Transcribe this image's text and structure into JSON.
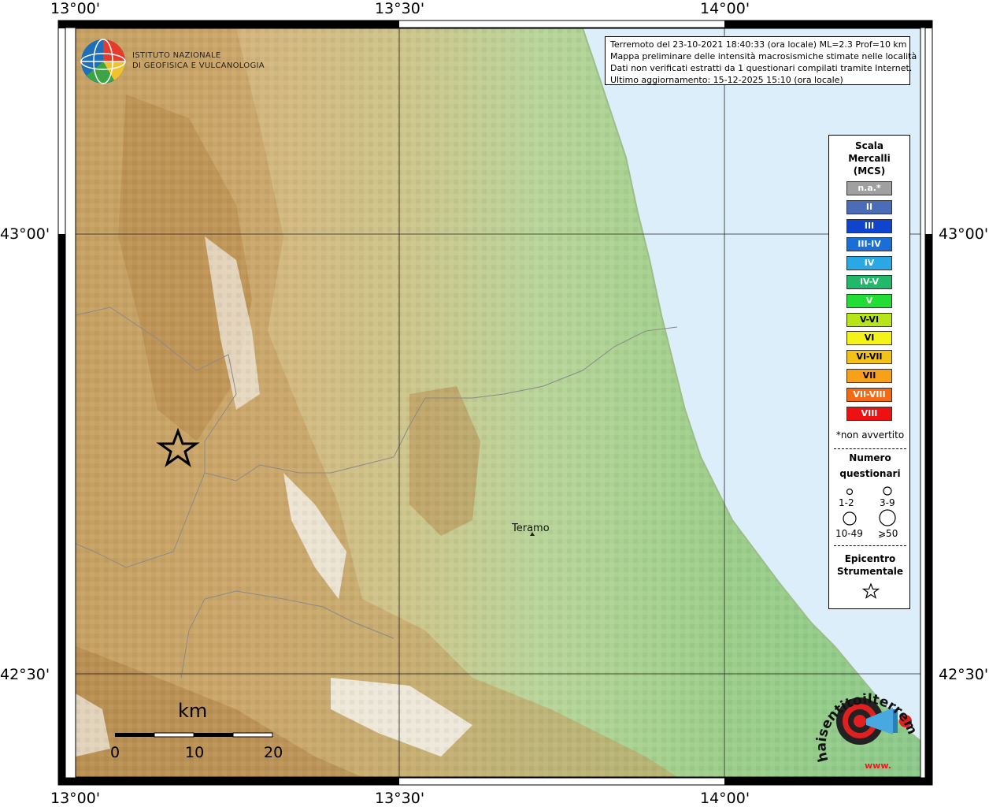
{
  "map": {
    "top_labels": [
      "13°00'",
      "13°30'",
      "14°00'"
    ],
    "bottom_labels": [
      "13°00'",
      "13°30'",
      "14°00'"
    ],
    "left_labels": [
      "43°00'",
      "42°30'"
    ],
    "right_labels": [
      "43°00'",
      "42°30'"
    ],
    "town": "Teramo",
    "epicenter_icon": "star-icon"
  },
  "institute": {
    "name_line1": "ISTITUTO NAZIONALE",
    "name_line2": "DI GEOFISICA E VULCANOLOGIA",
    "logo_icon": "globe-logo-icon"
  },
  "info": {
    "line1": "Terremoto del 23-10-2021 18:40:33 (ora locale) ML=2.3 Prof=10 km",
    "line2": "Mappa preliminare delle intensità macrosismiche stimate nelle località",
    "line3": "Dati non verificati estratti da 1 questionari compilati tramite Internet.",
    "line4": "Ultimo aggiornamento: 15-12-2025 15:10 (ora locale)"
  },
  "legend": {
    "title_line1": "Scala",
    "title_line2": "Mercalli",
    "title_line3": "(MCS)",
    "items": [
      {
        "label": "n.a.*",
        "color": "#a0a0a0"
      },
      {
        "label": "II",
        "color": "#4b6cb7"
      },
      {
        "label": "III",
        "color": "#1144cc"
      },
      {
        "label": "III-IV",
        "color": "#1a6fd6"
      },
      {
        "label": "IV",
        "color": "#2aa8e6"
      },
      {
        "label": "IV-V",
        "color": "#22b86a"
      },
      {
        "label": "V",
        "color": "#22dd33"
      },
      {
        "label": "V-VI",
        "color": "#b8e41a"
      },
      {
        "label": "VI",
        "color": "#f5f21a"
      },
      {
        "label": "VI-VII",
        "color": "#f2c21a"
      },
      {
        "label": "VII",
        "color": "#f7a11a"
      },
      {
        "label": "VII-VIII",
        "color": "#f56a14"
      },
      {
        "label": "VIII",
        "color": "#ee1111"
      }
    ],
    "note": "*non avvertito",
    "count_title1": "Numero",
    "count_title2": "questionari",
    "count_labels": [
      "1-2",
      "3-9",
      "10-49",
      "⩾50"
    ],
    "epi_title1": "Epicentro",
    "epi_title2": "Strumentale"
  },
  "scalebar": {
    "unit": "km",
    "ticks": [
      "0",
      "10",
      "20"
    ]
  },
  "brand": {
    "text": "haisentitoilterremoto.it",
    "url_text": "www.",
    "icon": "target-megaphone-icon"
  }
}
